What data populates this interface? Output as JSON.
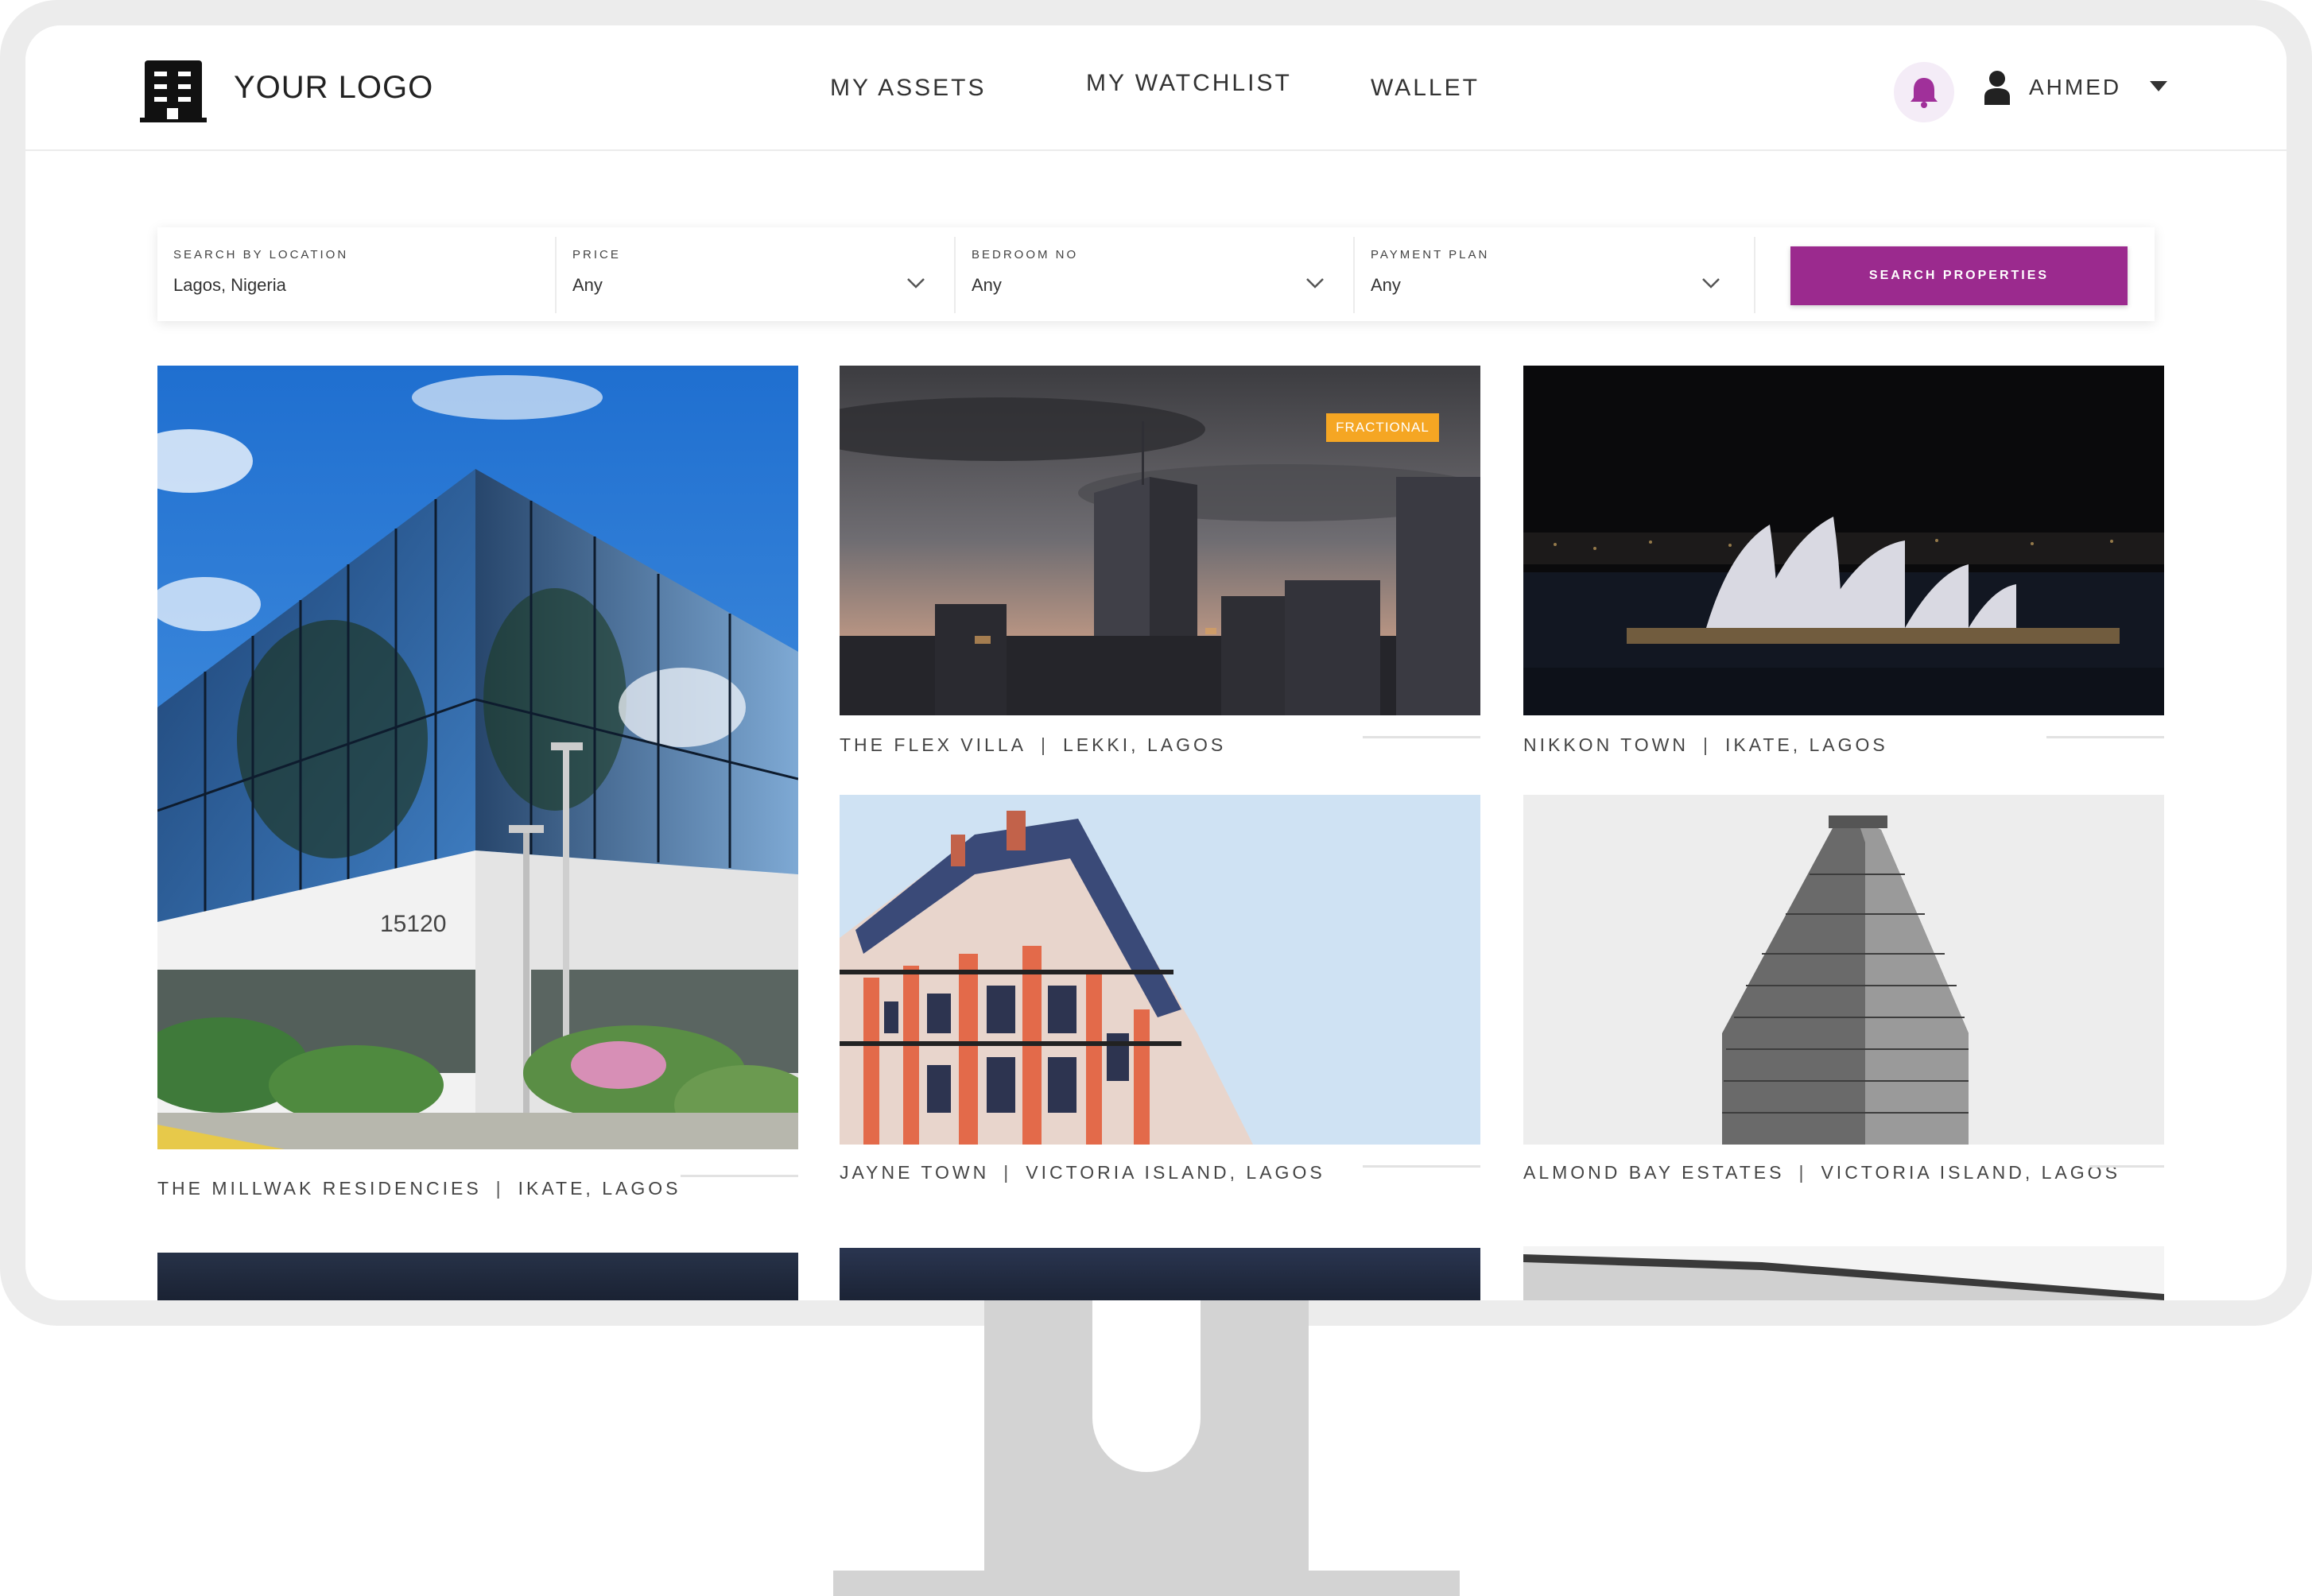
{
  "header": {
    "logo_text": "YOUR LOGO",
    "nav": [
      "MY ASSETS",
      "MY WATCHLIST",
      "WALLET"
    ],
    "user_name": "AHMED"
  },
  "search": {
    "location_label": "SEARCH BY LOCATION",
    "location_value": "Lagos, Nigeria",
    "price_label": "PRICE",
    "price_value": "Any",
    "bedroom_label": "BEDROOM NO",
    "bedroom_value": "Any",
    "payment_label": "PAYMENT PLAN",
    "payment_value": "Any",
    "button_label": "SEARCH PROPERTIES"
  },
  "properties": [
    {
      "name": "THE MILLWAK RESIDENCIES",
      "location": "IKATE, LAGOS"
    },
    {
      "name": "THE FLEX VILLA",
      "location": "LEKKI, LAGOS",
      "badge": "FRACTIONAL"
    },
    {
      "name": "NIKKON TOWN",
      "location": "IKATE, LAGOS"
    },
    {
      "name": "JAYNE TOWN",
      "location": "VICTORIA ISLAND, LAGOS"
    },
    {
      "name": "ALMOND BAY ESTATES",
      "location": "VICTORIA ISLAND, LAGOS"
    }
  ],
  "building_number": "15120",
  "colors": {
    "accent": "#9b2a8e",
    "badge": "#f5a623",
    "frame": "#ececec",
    "stand": "#d3d3d3"
  }
}
